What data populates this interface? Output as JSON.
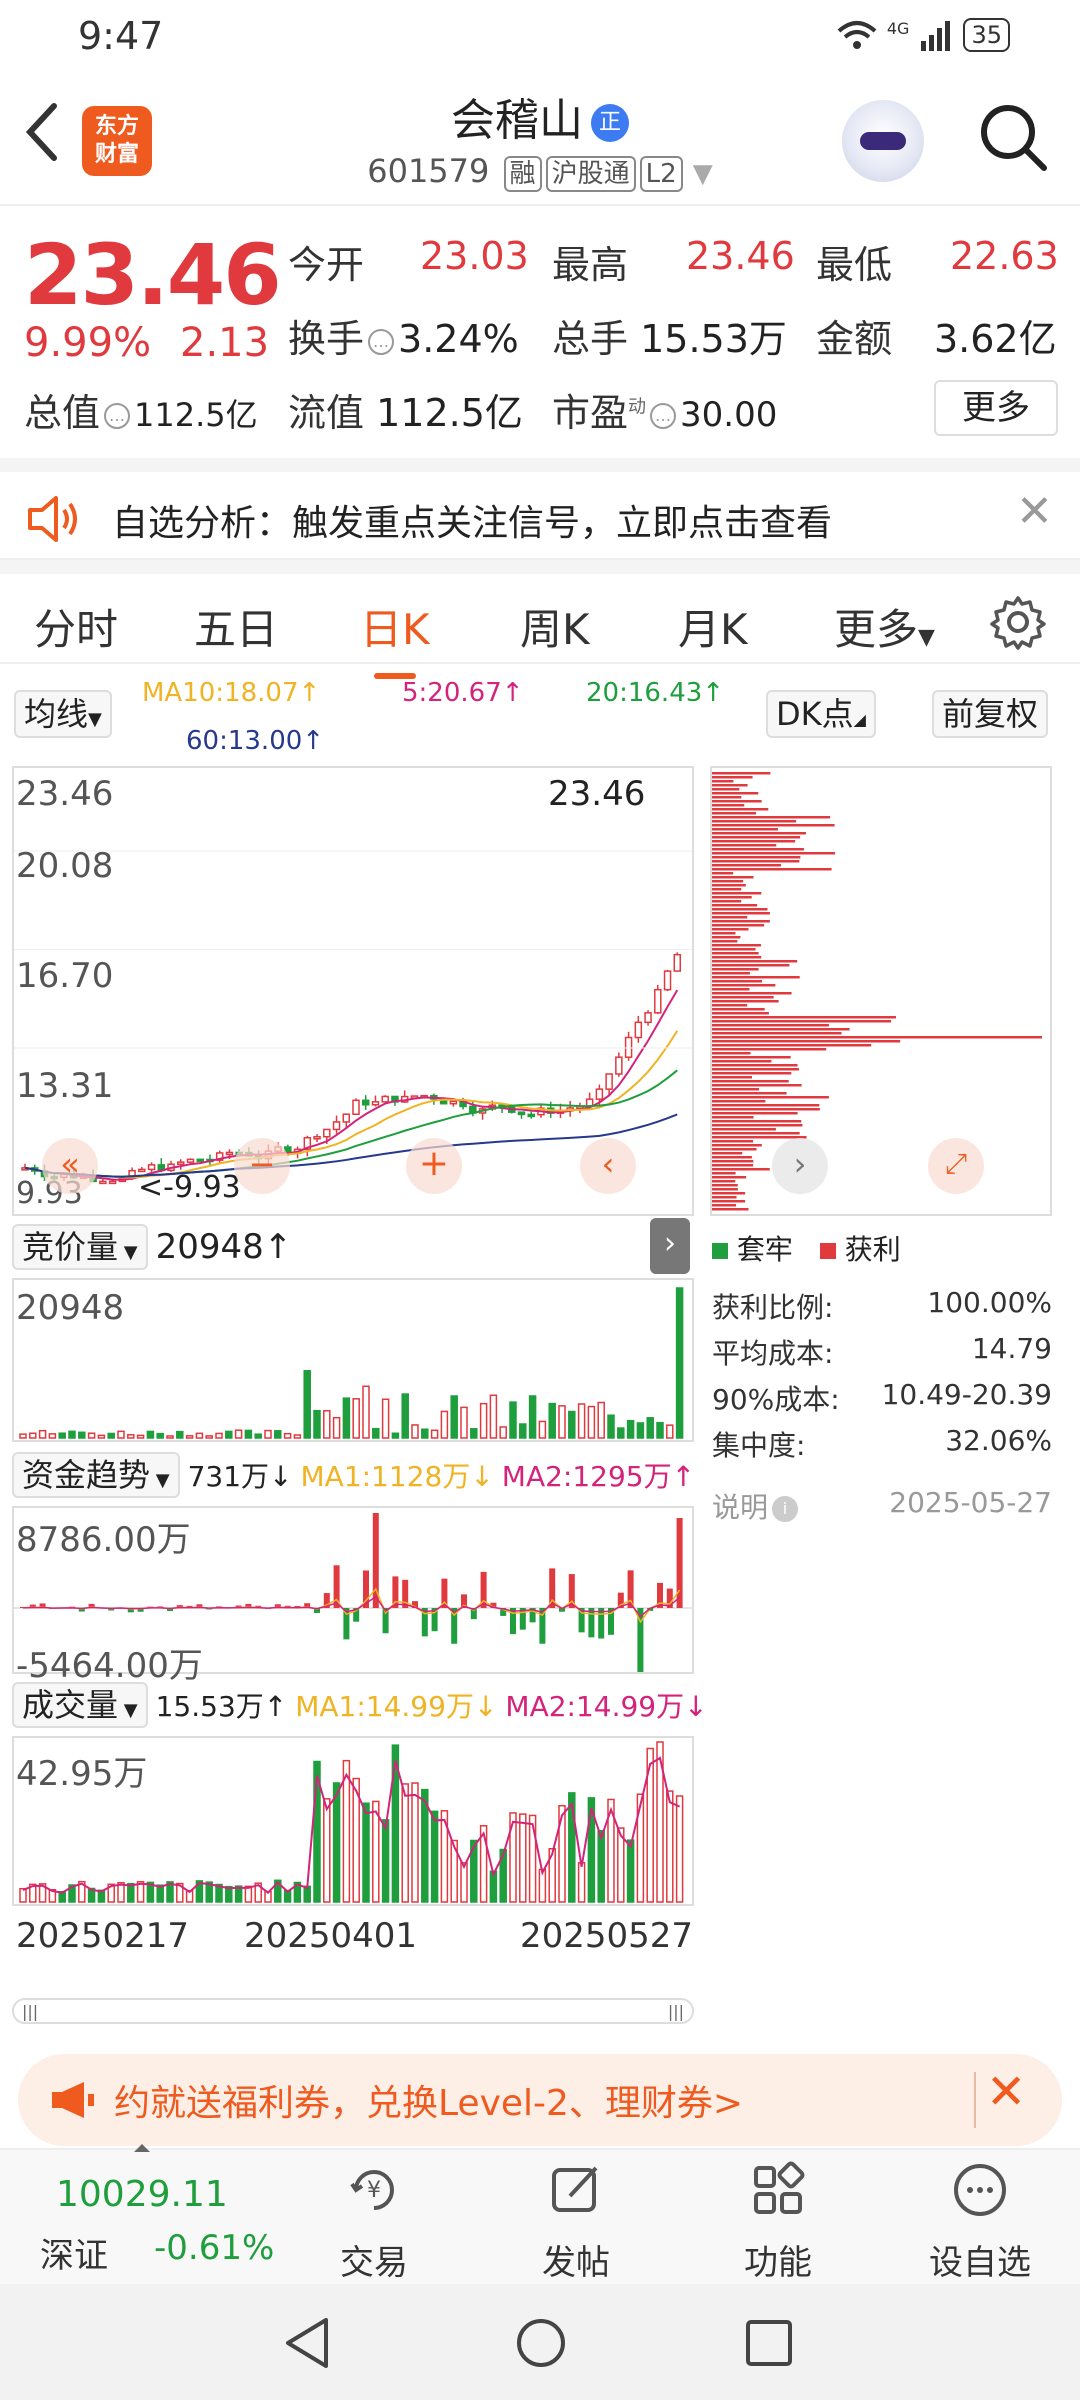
{
  "status_bar": {
    "time": "9:47",
    "network": "4G",
    "battery": "35"
  },
  "header": {
    "logo_text_1": "东方",
    "logo_text_2": "财富",
    "stock_name": "会稽山",
    "name_badge": "正",
    "stock_code": "601579",
    "tags": [
      "融",
      "沪股通",
      "L2"
    ]
  },
  "quote": {
    "price": "23.46",
    "change_pct": "9.99%",
    "change_amt": "2.13",
    "open_label": "今开",
    "open": "23.03",
    "high_label": "最高",
    "high": "23.46",
    "low_label": "最低",
    "low": "22.63",
    "turnover_label": "换手",
    "turnover": "3.24%",
    "volume_label": "总手",
    "volume": "15.53万",
    "amount_label": "金额",
    "amount": "3.62亿",
    "mktcap_label": "总值",
    "mktcap": "112.5亿",
    "float_label": "流值",
    "float": "112.5亿",
    "pe_label": "市盈",
    "pe_sup": "动",
    "pe": "30.00",
    "more": "更多"
  },
  "notice": {
    "text": "自选分析：触发重点关注信号，立即点击查看"
  },
  "tabs": {
    "items": [
      "分时",
      "五日",
      "日K",
      "周K",
      "月K",
      "更多"
    ],
    "active": "日K"
  },
  "ma_legend": {
    "selector": "均线",
    "ma10": "MA10:18.07↑",
    "ma5": "5:20.67↑",
    "ma20": "20:16.43↑",
    "ma60": "60:13.00↑",
    "dk": "DK点",
    "adjust": "前复权"
  },
  "kline": {
    "y_labels": [
      "23.46",
      "20.08",
      "16.70",
      "13.31",
      "9.93"
    ],
    "last_price_tag": "23.46",
    "low_tag": "<-9.93"
  },
  "colors": {
    "up": "#e0393e",
    "down": "#1e9e3c",
    "ma5": "#d4237a",
    "ma10": "#f0b323",
    "ma20": "#1e9e3c",
    "ma60": "#27388f",
    "accent": "#ef5a1e"
  },
  "auction": {
    "selector": "竞价量",
    "value": "20948↑",
    "y_label": "20948"
  },
  "fund": {
    "selector": "资金趋势",
    "value": "731万↓",
    "ma1": "MA1:1128万↓",
    "ma2": "MA2:1295万↑",
    "y_top": "8786.00万",
    "y_bottom": "-5464.00万"
  },
  "volume_panel": {
    "selector": "成交量",
    "value": "15.53万↑",
    "ma1": "MA1:14.99万↓",
    "ma2": "MA2:14.99万↓",
    "y_top": "42.95万"
  },
  "x_dates": [
    "20250217",
    "20250401",
    "20250527"
  ],
  "chips": {
    "legend_trapped": "套牢",
    "legend_profit": "获利",
    "rows": [
      {
        "label": "获利比例:",
        "value": "100.00%"
      },
      {
        "label": "平均成本:",
        "value": "14.79"
      },
      {
        "label": "90%成本:",
        "value": "10.49-20.39"
      },
      {
        "label": "集中度:",
        "value": "32.06%"
      }
    ],
    "note_label": "说明",
    "date": "2025-05-27"
  },
  "banner": {
    "text": "约就送福利券，兑换Level-2、理财券>"
  },
  "bottom_nav": {
    "index_value": "10029.11",
    "index_name": "深证",
    "index_change": "-0.61%",
    "items": [
      "交易",
      "发帖",
      "功能",
      "设自选"
    ]
  }
}
